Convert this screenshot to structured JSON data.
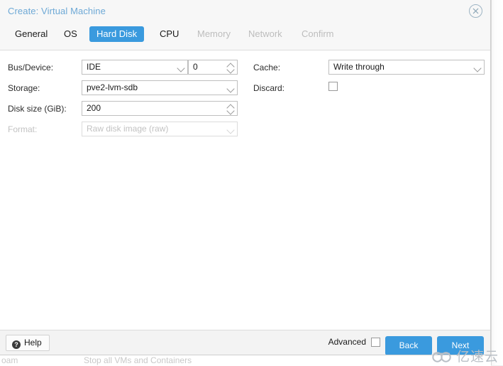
{
  "dialog": {
    "title": "Create: Virtual Machine",
    "close_icon": "close-circle-icon",
    "tabs": [
      {
        "label": "General",
        "state": "enabled"
      },
      {
        "label": "OS",
        "state": "enabled"
      },
      {
        "label": "Hard Disk",
        "state": "active"
      },
      {
        "label": "CPU",
        "state": "enabled"
      },
      {
        "label": "Memory",
        "state": "disabled"
      },
      {
        "label": "Network",
        "state": "disabled"
      },
      {
        "label": "Confirm",
        "state": "disabled"
      }
    ],
    "form": {
      "bus_device": {
        "label": "Bus/Device:",
        "value": "IDE",
        "index_value": "0"
      },
      "storage": {
        "label": "Storage:",
        "value": "pve2-lvm-sdb"
      },
      "disk_size": {
        "label": "Disk size (GiB):",
        "value": "200"
      },
      "format": {
        "label": "Format:",
        "value": "Raw disk image (raw)",
        "disabled": true
      },
      "cache": {
        "label": "Cache:",
        "value": "Write through"
      },
      "discard": {
        "label": "Discard:",
        "checked": false
      }
    },
    "footer": {
      "help_label": "Help",
      "help_icon": "question-mark-icon",
      "advanced_label": "Advanced",
      "advanced_checked": false,
      "back_label": "Back",
      "next_label": "Next"
    }
  },
  "background": {
    "row_cell_1": "oam",
    "row_cell_2": "Stop all VMs and Containers"
  },
  "watermark": {
    "text": "亿速云",
    "icon": "cloud-icon"
  },
  "colors": {
    "accent": "#3a9ade",
    "title": "#6ea9d6",
    "disabled_text": "#bdbdbd"
  }
}
